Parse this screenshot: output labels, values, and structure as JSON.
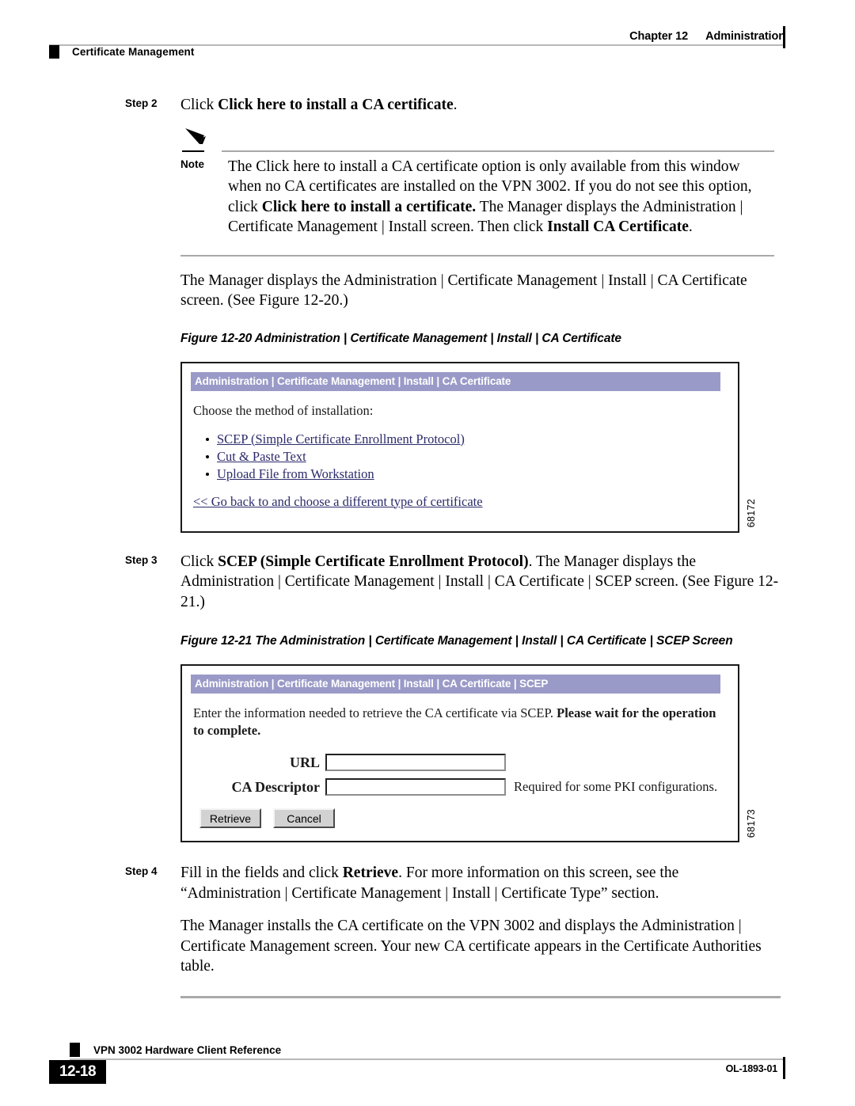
{
  "header": {
    "chapter": "Chapter 12",
    "section": "Administration",
    "running_head": "Certificate Management"
  },
  "steps": {
    "step2": {
      "label": "Step 2",
      "text_plain": "Click ",
      "text_bold": "Click here to install a CA certificate",
      "text_tail": "."
    },
    "step3": {
      "label": "Step 3",
      "lead": "Click ",
      "bold": "SCEP (Simple Certificate Enrollment Protocol)",
      "tail": ". The Manager displays the Administration | Certificate Management | Install | CA Certificate | SCEP screen. (See Figure 12-21.)"
    },
    "step4": {
      "label": "Step 4",
      "lead": "Fill in the fields and click ",
      "bold": "Retrieve",
      "tail": ". For more information on this screen, see the “Administration | Certificate Management | Install | Certificate Type” section.",
      "followup": "The Manager installs the CA certificate on the VPN 3002 and displays the Administration | Certificate Management screen. Your new CA certificate appears in the Certificate Authorities table."
    }
  },
  "note": {
    "label": "Note",
    "icon": "pencil-icon",
    "seg1": "The Click here to install a CA certificate option is only available from this window when no CA certificates are installed on the VPN 3002. If you do not see this option, click ",
    "seg2_bold": "Click here to install a certificate.",
    "seg3": " The Manager displays the Administration | Certificate Management | Install screen. Then click ",
    "seg4_bold": "Install CA Certificate",
    "seg5": "."
  },
  "body": {
    "para_after_note": "The Manager displays the Administration | Certificate Management | Install | CA Certificate screen. (See Figure 12-20.)"
  },
  "figure20": {
    "caption": "Figure 12-20 Administration | Certificate Management | Install | CA Certificate",
    "id": "68172",
    "titlebar": "Administration | Certificate Management | Install | CA Certificate",
    "lead": "Choose the method of installation:",
    "links": [
      "SCEP (Simple Certificate Enrollment Protocol)",
      "Cut & Paste Text",
      "Upload File from Workstation"
    ],
    "goback": "<< Go back to and choose a different type of certificate",
    "titlebar_color": "#9a9ac8",
    "link_color": "#2b2b6b"
  },
  "figure21": {
    "caption": "Figure 12-21 The Administration | Certificate Management | Install | CA Certificate | SCEP Screen",
    "id": "68173",
    "titlebar": "Administration | Certificate Management | Install | CA Certificate | SCEP",
    "lead_plain": "Enter the information needed to retrieve the CA certificate via SCEP. ",
    "lead_bold": "Please wait for the operation to complete.",
    "fields": [
      {
        "label": "URL",
        "value": "",
        "hint": ""
      },
      {
        "label": "CA Descriptor",
        "value": "",
        "hint": "Required for some PKI configurations."
      }
    ],
    "buttons": [
      {
        "label": "Retrieve"
      },
      {
        "label": "Cancel"
      }
    ],
    "titlebar_color": "#9a9ac8"
  },
  "footer": {
    "doc_title": "VPN 3002 Hardware Client Reference",
    "page_number": "12-18",
    "doc_id": "OL-1893-01"
  }
}
